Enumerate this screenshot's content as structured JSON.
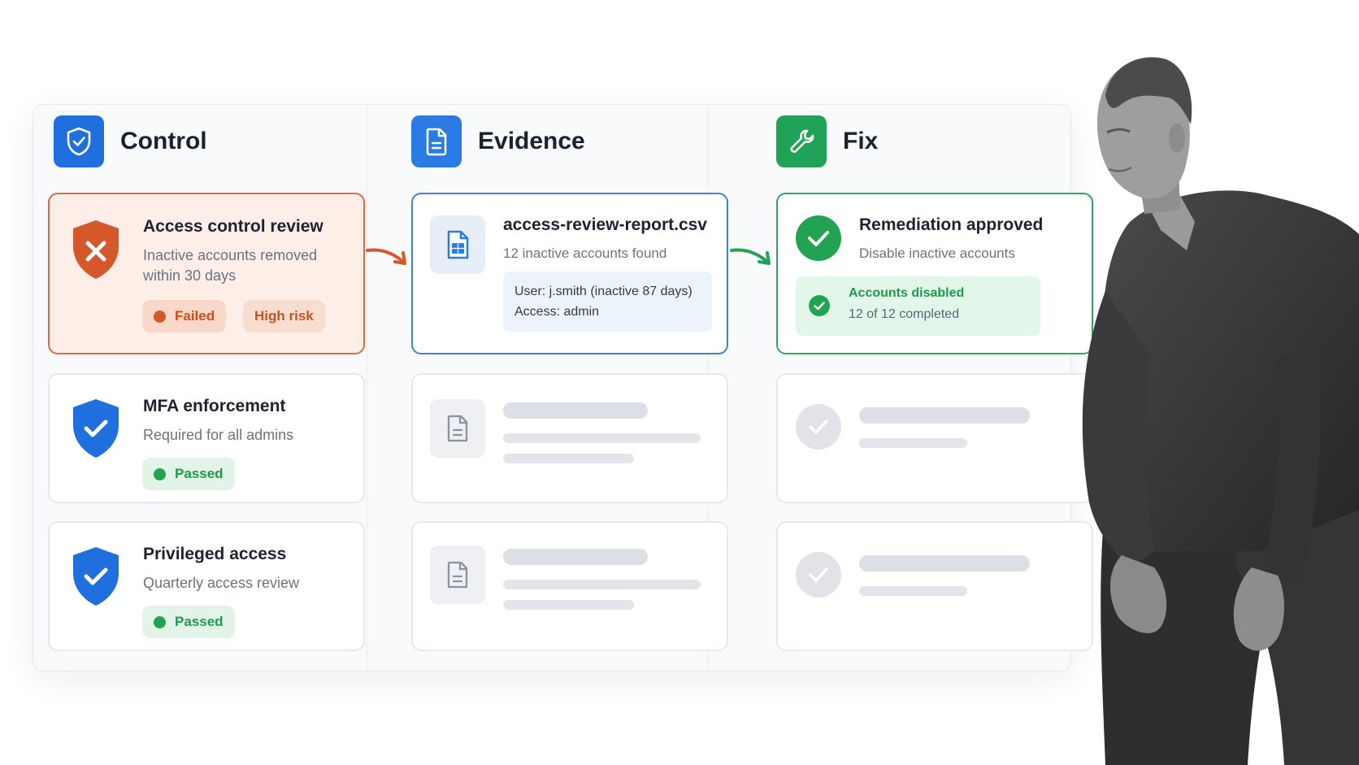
{
  "columns": {
    "control": {
      "title": "Control",
      "color": "#1f6fde"
    },
    "evidence": {
      "title": "Evidence",
      "color": "#2a7be4"
    },
    "fix": {
      "title": "Fix",
      "color": "#21a357"
    }
  },
  "control_cards": [
    {
      "title": "Access control review",
      "subtitle_line1": "Inactive accounts removed",
      "subtitle_line2": "within 30 days",
      "status": "Failed",
      "risk": "High risk",
      "icon": "x-shield-icon"
    },
    {
      "title": "MFA enforcement",
      "subtitle": "Required for all admins",
      "status": "Passed",
      "icon": "check-shield-icon"
    },
    {
      "title": "Privileged access",
      "subtitle": "Quarterly access review",
      "status": "Passed",
      "icon": "check-shield-icon"
    }
  ],
  "evidence_card": {
    "filename": "access-review-report.csv",
    "summary": "12 inactive accounts found",
    "detail_line1": "User: j.smith (inactive 87 days)",
    "detail_line2": "Access: admin"
  },
  "fix_card": {
    "title": "Remediation approved",
    "subtitle": "Disable inactive accounts",
    "result_title": "Accounts disabled",
    "result_detail": "12 of 12 completed"
  },
  "colors": {
    "fail": "#d4582a",
    "pass": "#22a352",
    "evidence_accent": "#3d82d6"
  }
}
